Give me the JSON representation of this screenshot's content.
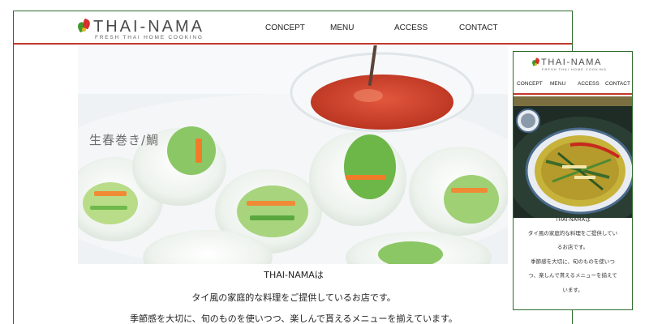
{
  "brand": {
    "name": "THAI-NAMA",
    "tagline": "FRESH THAI HOME COOKING",
    "colors": {
      "accent_red": "#c0392b",
      "frame_green": "#2e6b2e",
      "leaf_green": "#3f9a2b",
      "leaf_red": "#d6302b",
      "leaf_yellow": "#e6b317"
    }
  },
  "desktop": {
    "nav": [
      "CONCEPT",
      "MENU",
      "ACCESS",
      "CONTACT"
    ],
    "hero": {
      "caption": "生春巻き/鯛",
      "image": "spring-rolls-photo"
    },
    "body": [
      "THAI-NAMAは",
      "タイ風の家庭的な料理をご提供しているお店です。",
      "季節感を大切に、旬のものを使いつつ、楽しんで貰えるメニューを揃えています。"
    ]
  },
  "mobile": {
    "nav": [
      "CONCEPT",
      "MENU",
      "ACCESS",
      "CONTACT"
    ],
    "hero": {
      "image": "curry-bowl-photo"
    },
    "body": [
      "THAI-NAMAは",
      "タイ風の家庭的な料理をご提供してい",
      "るお店です。",
      "季節感を大切に、旬のものを使いつ",
      "つ、楽しんで貰えるメニューを揃えて",
      "います。"
    ]
  }
}
